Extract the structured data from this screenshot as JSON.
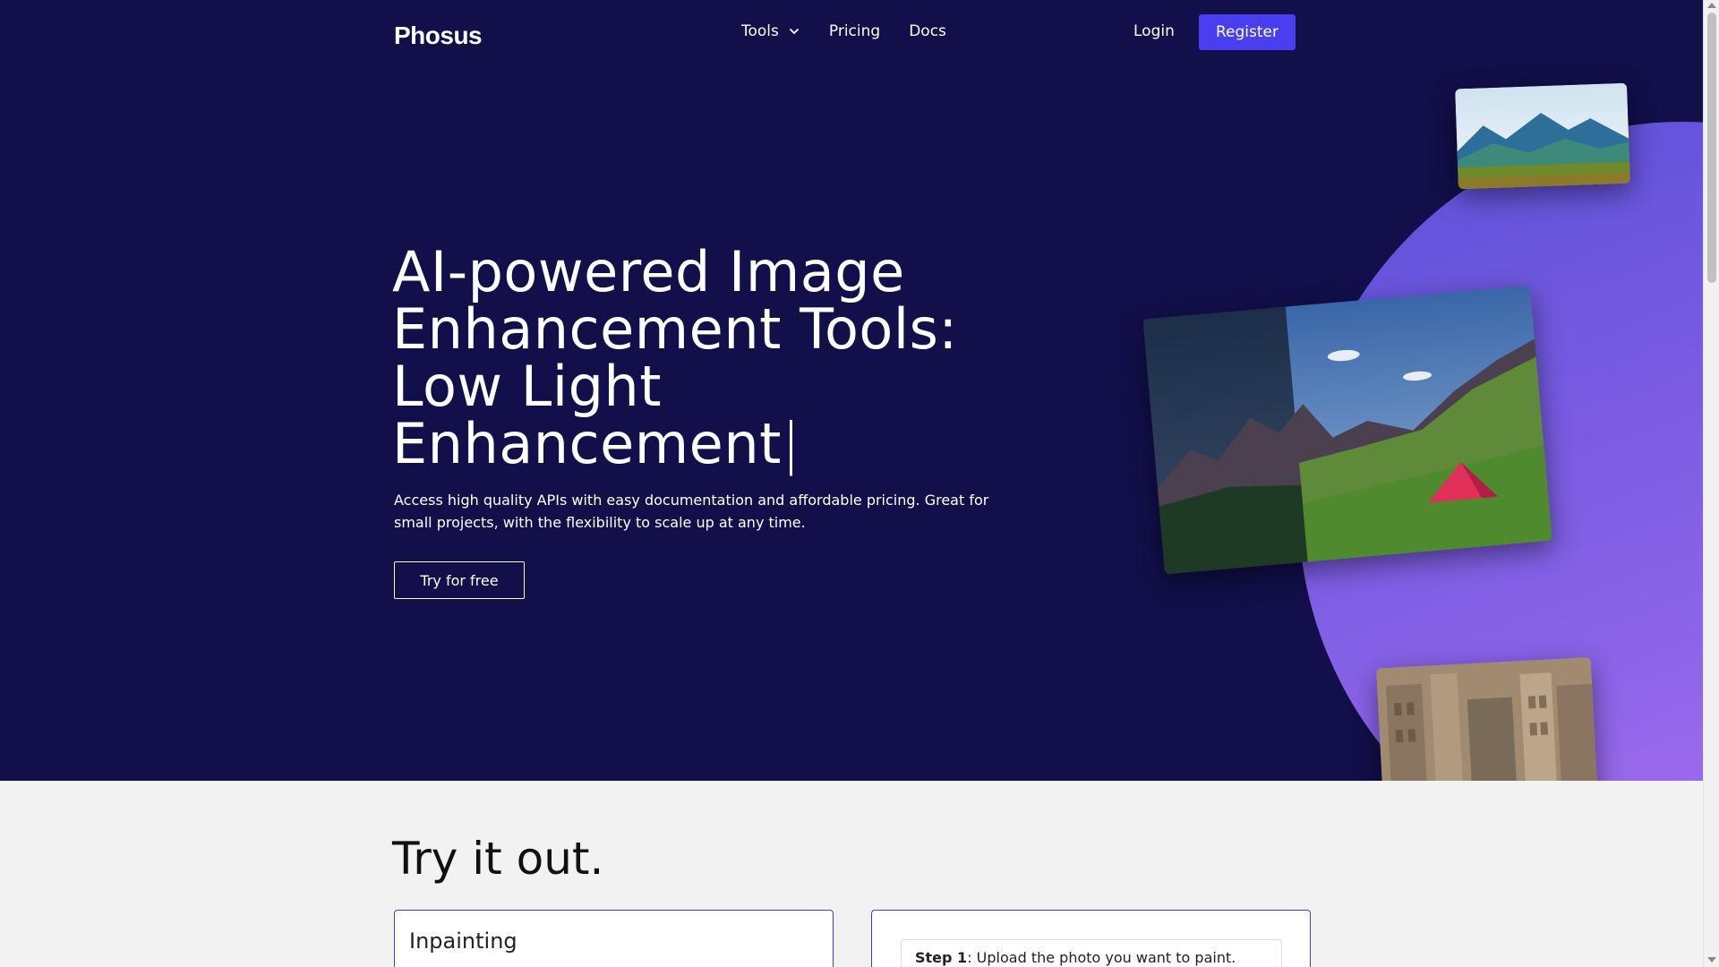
{
  "brand": {
    "logo": "Phosus"
  },
  "nav": {
    "tools_label": "Tools",
    "pricing_label": "Pricing",
    "docs_label": "Docs",
    "login_label": "Login",
    "register_label": "Register"
  },
  "hero": {
    "headline_line1": "AI-powered Image",
    "headline_line2": "Enhancement Tools:",
    "headline_line3": "Low Light",
    "headline_line4": "Enhancement",
    "cursor": "|",
    "subtext": "Access high quality APIs with easy documentation and affordable pricing. Great for small projects, with the flexibility to scale up at any time.",
    "cta_label": "Try for free"
  },
  "try_section": {
    "title": "Try it out.",
    "left_card_title": "Inpainting",
    "step_label": "Step 1",
    "step_text": ": Upload the photo you want to paint."
  },
  "colors": {
    "hero_bg": "#120f4a",
    "accent": "#4a3ff0",
    "circle": "#7a5ce6"
  }
}
